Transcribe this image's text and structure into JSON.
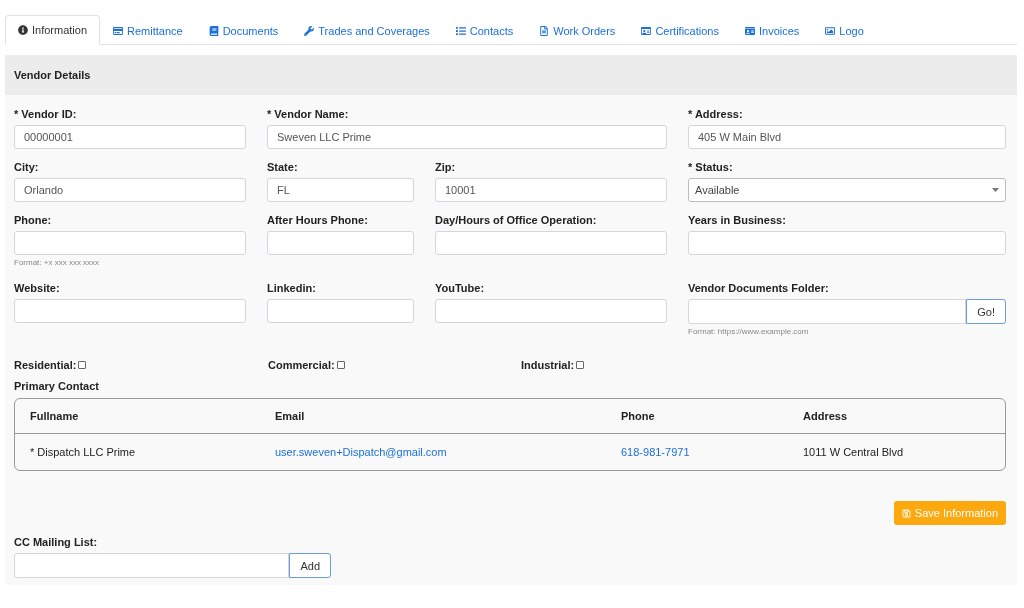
{
  "tabs": [
    {
      "label": "Information",
      "selected": true
    },
    {
      "label": "Remittance",
      "selected": false
    },
    {
      "label": "Documents",
      "selected": false
    },
    {
      "label": "Trades and Coverages",
      "selected": false
    },
    {
      "label": "Contacts",
      "selected": false
    },
    {
      "label": "Work Orders",
      "selected": false
    },
    {
      "label": "Certifications",
      "selected": false
    },
    {
      "label": "Invoices",
      "selected": false
    },
    {
      "label": "Logo",
      "selected": false
    }
  ],
  "panel": {
    "title": "Vendor Details",
    "field_rows": [
      [
        {
          "label": "* Vendor ID:",
          "kind": "text",
          "value": "00000001"
        },
        {
          "label": "* Vendor Name:",
          "kind": "text",
          "value": "Sweven LLC Prime"
        },
        {
          "label": "* Address:",
          "kind": "text",
          "value": "405 W Main Blvd"
        }
      ],
      [
        {
          "label": "City:",
          "kind": "text",
          "value": "Orlando"
        },
        {
          "label": "State:",
          "kind": "text",
          "value": "FL"
        },
        {
          "label": "Zip:",
          "kind": "text",
          "value": "10001"
        },
        {
          "label": "* Status:",
          "kind": "select",
          "value": "Available"
        }
      ],
      [
        {
          "label": "Phone:",
          "kind": "text",
          "help": "Format: +x xxx xxx xxxx"
        },
        {
          "label": "After Hours Phone:",
          "kind": "text"
        },
        {
          "label": "Day/Hours of Office Operation:",
          "kind": "text"
        },
        {
          "label": "Years in Business:",
          "kind": "text"
        }
      ],
      [
        {
          "label": "Website:",
          "kind": "text"
        },
        {
          "label": "Linkedin:",
          "kind": "text"
        },
        {
          "label": "YouTube:",
          "kind": "text"
        },
        {
          "label": "Vendor Documents Folder:",
          "kind": "button",
          "button": "Go!",
          "help": "Format: https://www.example.com"
        }
      ]
    ],
    "checkboxes": [
      {
        "label": "Residential:",
        "checked": false
      },
      {
        "label": "Commercial:",
        "checked": false
      },
      {
        "label": "Industrial:",
        "checked": false
      }
    ],
    "primary_contact": {
      "title": "Primary Contact",
      "columns": [
        "Fullname",
        "Email",
        "Phone",
        "Address"
      ],
      "rows": [
        [
          {
            "text": "* Dispatch LLC Prime",
            "kind": "text"
          },
          {
            "text": "user.sweven+Dispatch@gmail.com",
            "kind": "link"
          },
          {
            "text": "618-981-7971",
            "kind": "link"
          },
          {
            "text": "1011 W Central Blvd",
            "kind": "text"
          }
        ]
      ]
    },
    "save_button": "Save Information",
    "cc_mailing_list": {
      "label": "CC Mailing List:",
      "button": "Add"
    }
  }
}
